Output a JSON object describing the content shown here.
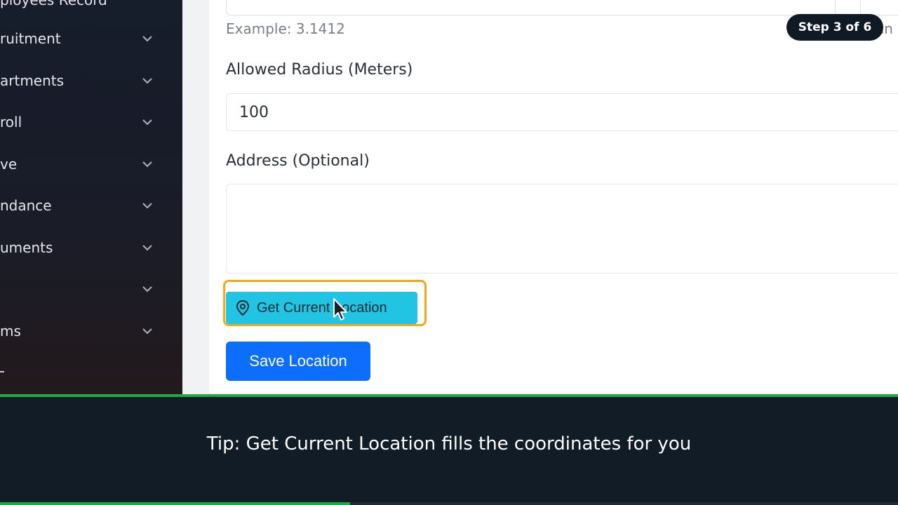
{
  "sidebar": {
    "top_partial": "ployees Record",
    "items": [
      {
        "label": "ruitment"
      },
      {
        "label": "artments"
      },
      {
        "label": "roll"
      },
      {
        "label": "ve"
      },
      {
        "label": "ndance"
      },
      {
        "label": "uments"
      },
      {
        "label": ""
      },
      {
        "label": "ms"
      }
    ],
    "bottom_partial": "-"
  },
  "form": {
    "hint": "Example: 3.1412",
    "hint_right_partial": "an",
    "radius": {
      "label": "Allowed Radius (Meters)",
      "value": "100"
    },
    "address": {
      "label": "Address (Optional)",
      "value": ""
    },
    "get_location_label": "Get Current Location",
    "save_label": "Save Location"
  },
  "step_badge": "Step 3 of 6",
  "caption": "Tip: Get Current Location fills the coordinates for you",
  "progress": {
    "fraction": 0.39
  },
  "colors": {
    "sidebar_bg": "#161d2b",
    "highlight": "#f0a81c",
    "location_button": "#22c4e3",
    "save_button": "#0d6efd",
    "caption_bg": "#111c26",
    "progress": "#22a845"
  },
  "icons": {
    "chevron": "chevron-down-icon",
    "pin": "map-pin-icon",
    "cursor": "mouse-pointer-icon"
  }
}
